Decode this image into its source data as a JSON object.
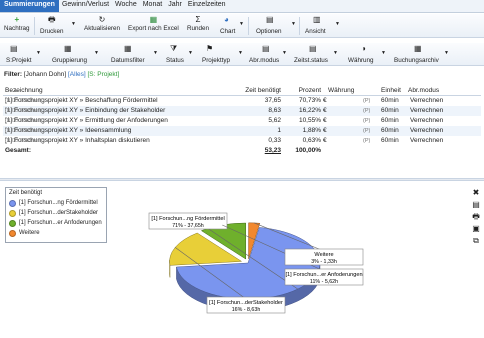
{
  "tabs": [
    "Summierungen",
    "Gewinn/Verlust",
    "Woche",
    "Monat",
    "Jahr",
    "Einzelzeiten"
  ],
  "ribbon1": {
    "nachtrag": "Nachtrag",
    "drucken": "Drucken",
    "aktualisieren": "Aktualisieren",
    "export": "Export nach Excel",
    "runden": "Runden",
    "chart": "Chart",
    "optionen": "Optionen",
    "ansicht": "Ansicht"
  },
  "ribbon2": {
    "sprojekt": "S:Projekt",
    "gruppierung": "Gruppierung",
    "datumsfilter": "Datumsfilter",
    "status": "Status",
    "projekttyp": "Projekttyp",
    "abrmodus": "Abr.modus",
    "zeitstatus": "Zeitst.status",
    "waehrung": "Währung",
    "buchungsarchiv": "Buchungsarchiv"
  },
  "filter": {
    "label": "Filter:",
    "user": "[Johann Dohn]",
    "alles": "[Alles]",
    "sprojekt": "[S: Projekt]"
  },
  "table": {
    "headers": {
      "name": "Bezeichnung",
      "time": "Zeit benötigt",
      "pct": "Prozent",
      "cur": "Währung",
      "unit": "Einheit",
      "mode": "Abr.modus"
    },
    "rows": [
      {
        "name": "[1] Forschungsprojekt XY » Beschaffung Fördermittel",
        "cost": "(0,00 €/60min)",
        "time": "37,65",
        "pct": "70,73%",
        "cur": "€",
        "flag": "(P)",
        "unit": "60min",
        "mode": "Verrechnen"
      },
      {
        "name": "[1] Forschungsprojekt XY » Einbindung der Stakeholder",
        "cost": "(0,00 €/60min)",
        "time": "8,63",
        "pct": "16,22%",
        "cur": "€",
        "flag": "(P)",
        "unit": "60min",
        "mode": "Verrechnen"
      },
      {
        "name": "[1] Forschungsprojekt XY » Ermittlung der Anfoderungen",
        "cost": "(0,00 €/60min)",
        "time": "5,62",
        "pct": "10,55%",
        "cur": "€",
        "flag": "(P)",
        "unit": "60min",
        "mode": "Verrechnen"
      },
      {
        "name": "[1] Forschungsprojekt XY » Ideensammlung",
        "cost": "(0,00 €/60min)",
        "time": "1",
        "pct": "1,88%",
        "cur": "€",
        "flag": "(P)",
        "unit": "60min",
        "mode": "Verrechnen"
      },
      {
        "name": "[1] Forschungsprojekt XY » Inhaltsplan diskutieren",
        "cost": "(0,00 €/60min)",
        "time": "0,33",
        "pct": "0,63%",
        "cur": "€",
        "flag": "(P)",
        "unit": "60min",
        "mode": "Verrechnen"
      }
    ],
    "total": {
      "label": "Gesamt:",
      "time": "53,23",
      "pct": "100,00%"
    }
  },
  "chart_data": {
    "type": "pie",
    "title": "",
    "legend_title": "Zeit benötigt",
    "legend_placement": "top-left",
    "slices": [
      {
        "legend": "[1] Forschun...ng Fördermittel",
        "label": "[1] Forschun...ng Fördermittel",
        "detail": "71% - 37,65h",
        "value": 37.65,
        "color": "#7a95ef"
      },
      {
        "legend": "[1] Forschun...derStakeholder",
        "label": "[1] Forschun...derStakeholder",
        "detail": "16% - 8,63h",
        "value": 8.63,
        "color": "#e8cf38"
      },
      {
        "legend": "[1] Forschun...er Anfoderungen",
        "label": "[1] Forschun...er Anfoderungen",
        "detail": "11% - 5,62h",
        "value": 5.62,
        "color": "#6fb02c"
      },
      {
        "legend": "Weitere",
        "label": "Weitere",
        "detail": "3% - 1,33h",
        "value": 1.33,
        "color": "#f2882e"
      }
    ]
  }
}
